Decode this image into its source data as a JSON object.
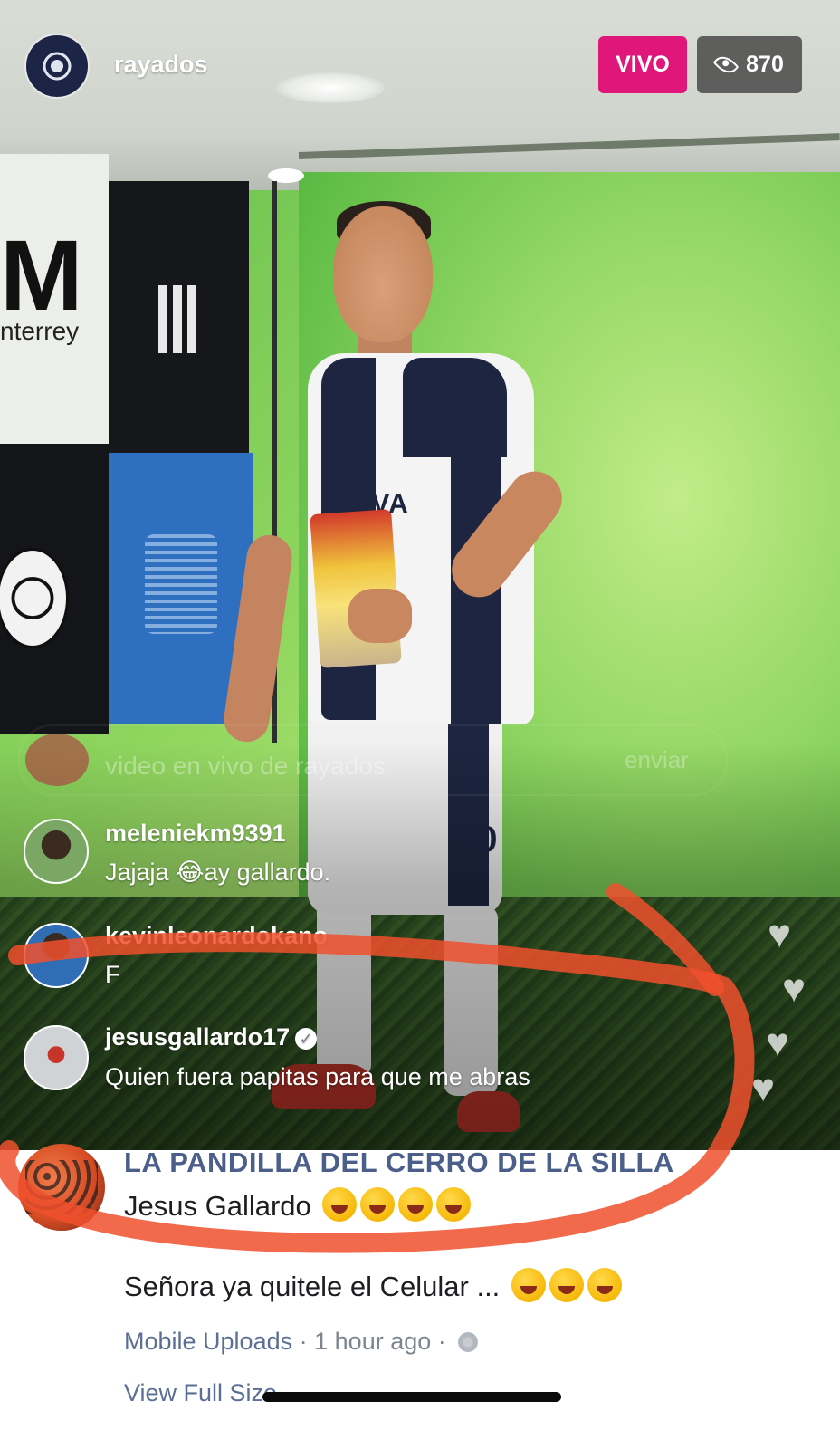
{
  "live": {
    "username": "rayados",
    "live_label": "VIVO",
    "viewer_count": "870",
    "comment_placeholder": "video en vivo de rayados",
    "send_label": "enviar",
    "comments": [
      {
        "user": "meleniekm9391",
        "text": "Jajaja 😂ay gallardo.",
        "verified": false
      },
      {
        "user": "kevinleonardokano",
        "text": "F",
        "verified": false
      },
      {
        "user": "jesusgallardo17",
        "text": "Quien fuera papitas para que me abras",
        "verified": true
      }
    ],
    "scene_text": {
      "wall_sign": "nterrey",
      "sponsor": "BBVA",
      "shorts_number": "20"
    }
  },
  "post_comment": {
    "author": "LA PANDILLA DEL CERRO DE LA SILLA",
    "text": "Jesus Gallardo",
    "reply_text": "Señora ya quitele el Celular ...",
    "album_link": "Mobile Uploads",
    "separator": "·",
    "timestamp": "1 hour ago",
    "view_full_size": "View Full Size"
  },
  "colors": {
    "live_badge": "#e0167b",
    "fb_name": "#4b5f8a",
    "annotation_stroke": "#f0502d"
  },
  "icons": {
    "viewers": "eye-icon",
    "verified": "verified-icon",
    "privacy": "globe-icon",
    "reaction": "heart-icon"
  }
}
